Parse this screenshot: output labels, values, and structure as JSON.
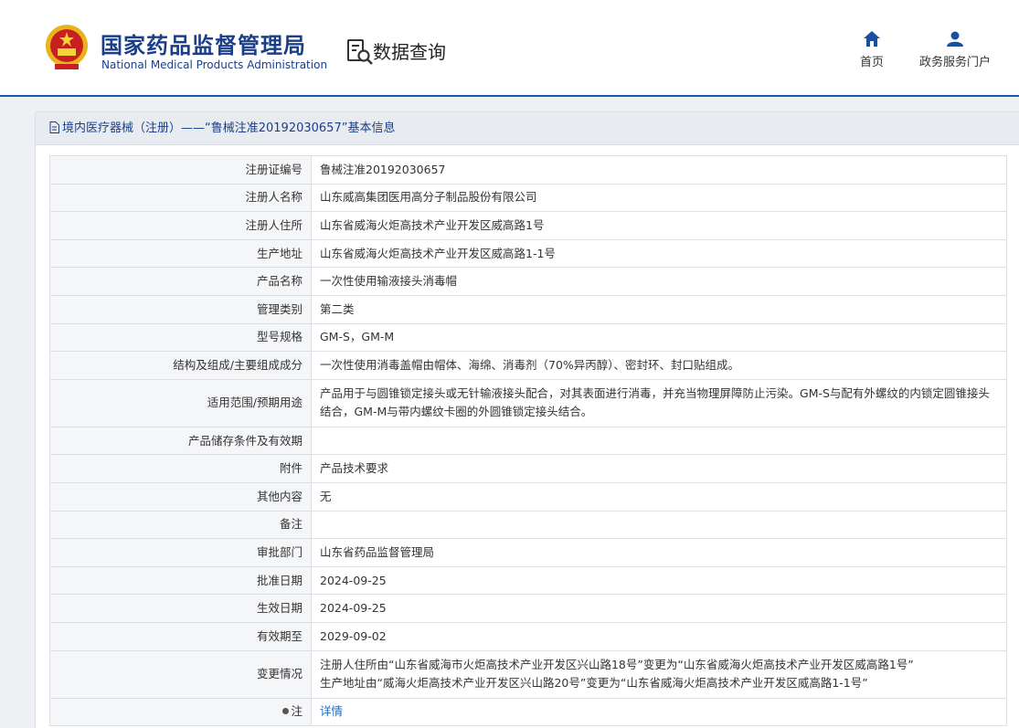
{
  "header": {
    "org_name_cn": "国家药品监督管理局",
    "org_name_en": "National Medical Products Administration",
    "query_title": "数据查询",
    "nav": [
      {
        "label": "首页",
        "icon": "home-icon"
      },
      {
        "label": "政务服务门户",
        "icon": "user-icon"
      }
    ]
  },
  "panel": {
    "title": "境内医疗器械（注册）——“鲁械注准20192030657”基本信息"
  },
  "rows": [
    {
      "label": "注册证编号",
      "value": "鲁械注准20192030657"
    },
    {
      "label": "注册人名称",
      "value": "山东威高集团医用高分子制品股份有限公司"
    },
    {
      "label": "注册人住所",
      "value": "山东省威海火炬高技术产业开发区威高路1号"
    },
    {
      "label": "生产地址",
      "value": "山东省威海火炬高技术产业开发区威高路1-1号"
    },
    {
      "label": "产品名称",
      "value": "一次性使用输液接头消毒帽"
    },
    {
      "label": "管理类别",
      "value": "第二类"
    },
    {
      "label": "型号规格",
      "value": "GM-S，GM-M"
    },
    {
      "label": "结构及组成/主要组成成分",
      "value": "一次性使用消毒盖帽由帽体、海绵、消毒剂（70%异丙醇）、密封环、封口贴组成。"
    },
    {
      "label": "适用范围/预期用途",
      "value": "产品用于与圆锥锁定接头或无针输液接头配合，对其表面进行消毒，并充当物理屏障防止污染。GM-S与配有外螺纹的内锁定圆锥接头结合，GM-M与带内螺纹卡圈的外圆锥锁定接头结合。"
    },
    {
      "label": "产品储存条件及有效期",
      "value": ""
    },
    {
      "label": "附件",
      "value": "产品技术要求"
    },
    {
      "label": "其他内容",
      "value": "无"
    },
    {
      "label": "备注",
      "value": ""
    },
    {
      "label": "审批部门",
      "value": "山东省药品监督管理局"
    },
    {
      "label": "批准日期",
      "value": "2024-09-25"
    },
    {
      "label": "生效日期",
      "value": "2024-09-25"
    },
    {
      "label": "有效期至",
      "value": "2029-09-02"
    },
    {
      "label": "变更情况",
      "value_lines": [
        "注册人住所由“山东省威海市火炬高技术产业开发区兴山路18号”变更为“山东省威海火炬高技术产业开发区威高路1号”",
        "生产地址由“威海火炬高技术产业开发区兴山路20号”变更为“山东省威海火炬高技术产业开发区威高路1-1号”"
      ]
    },
    {
      "label": "注",
      "link": "详情"
    }
  ],
  "colors": {
    "brand_blue": "#1a3f8a",
    "header_line": "#1a5aa8",
    "link": "#1a6bc2",
    "emblem_red": "#c8201f",
    "emblem_gold": "#e8b31c"
  }
}
